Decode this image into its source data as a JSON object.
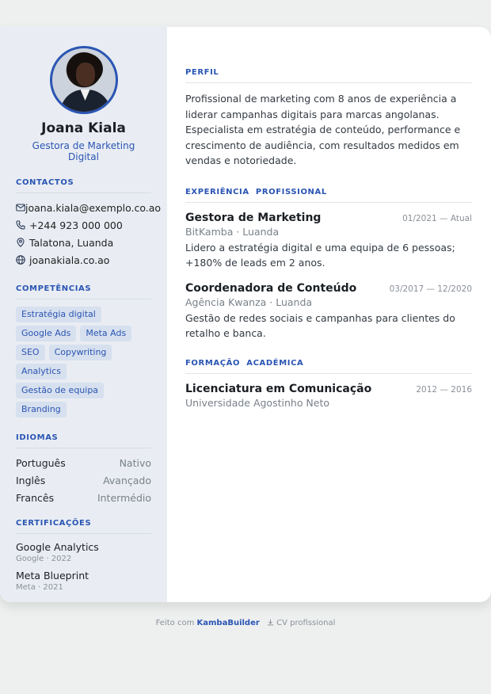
{
  "profile": {
    "name": "Joana Kiala",
    "role": "Gestora de Marketing Digital"
  },
  "contacts": {
    "title": "CONTACTOS",
    "email": "joana.kiala@exemplo.co.ao",
    "phone": "+244 923 000 000",
    "location": "Talatona, Luanda",
    "website": "joanakiala.co.ao"
  },
  "skills": {
    "title": "COMPETÊNCIAS",
    "items": [
      "Estratégia digital",
      "Google Ads",
      "Meta Ads",
      "SEO",
      "Copywriting",
      "Analytics",
      "Gestão de equipa",
      "Branding"
    ]
  },
  "languages": {
    "title": "IDIOMAS",
    "items": [
      {
        "name": "Português",
        "level": "Nativo"
      },
      {
        "name": "Inglês",
        "level": "Avançado"
      },
      {
        "name": "Francês",
        "level": "Intermédio"
      }
    ]
  },
  "certifications": {
    "title": "CERTIFICAÇÕES",
    "items": [
      {
        "name": "Google Analytics",
        "meta": "Google · 2022"
      },
      {
        "name": "Meta Blueprint",
        "meta": "Meta · 2021"
      }
    ]
  },
  "summary": {
    "title": "PERFIL",
    "text": "Profissional de marketing com 8 anos de experiência a liderar campanhas digitais para marcas angolanas. Especialista em estratégia de conteúdo, performance e crescimento de audiência, com resultados medidos em vendas e notoriedade."
  },
  "experience": {
    "title": "EXPERIÊNCIA  PROFISSIONAL",
    "items": [
      {
        "title": "Gestora de Marketing",
        "date": "01/2021 — Atual",
        "org": "BitKamba · Luanda",
        "desc": "Lidero a estratégia digital e uma equipa de 6 pessoas; +180% de leads em 2 anos."
      },
      {
        "title": "Coordenadora de Conteúdo",
        "date": "03/2017 — 12/2020",
        "org": "Agência Kwanza · Luanda",
        "desc": "Gestão de redes sociais e campanhas para clientes do retalho e banca."
      }
    ]
  },
  "education": {
    "title": "FORMAÇÃO  ACADÉMICA",
    "items": [
      {
        "title": "Licenciatura em Comunicação",
        "date": "2012 — 2016",
        "org": "Universidade Agostinho Neto"
      }
    ]
  },
  "footer": {
    "prefix": "Feito com",
    "brand": "KambaBuilder",
    "badge": "CV profissional"
  },
  "icons": {
    "email": "mail-icon",
    "phone": "phone-icon",
    "location": "map-pin-icon",
    "website": "globe-icon",
    "download": "download-icon"
  },
  "colors": {
    "accent": "#2a55b3",
    "sidebar": "#e9edf3",
    "tag_bg": "#d7e0ee"
  }
}
